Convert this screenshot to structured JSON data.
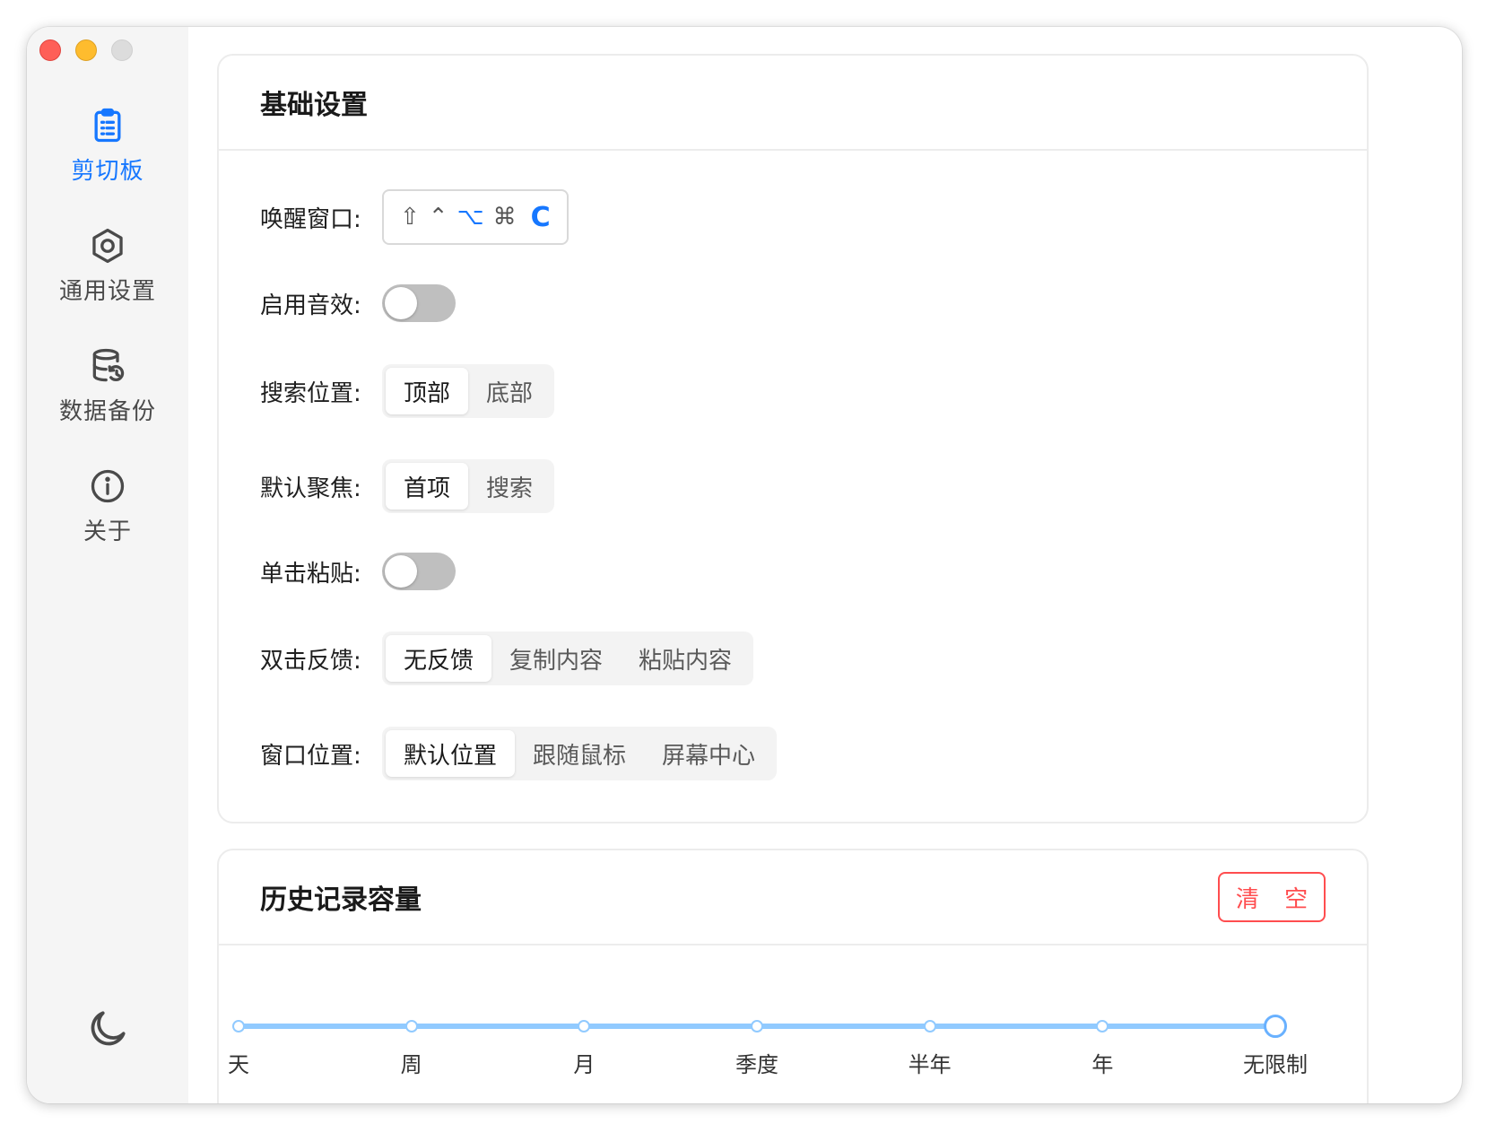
{
  "sidebar": {
    "items": [
      {
        "label": "剪切板",
        "icon": "clipboard-icon",
        "active": true
      },
      {
        "label": "通用设置",
        "icon": "settings-hexagon-icon",
        "active": false
      },
      {
        "label": "数据备份",
        "icon": "database-backup-icon",
        "active": false
      },
      {
        "label": "关于",
        "icon": "info-circle-icon",
        "active": false
      }
    ],
    "theme_toggle_icon": "moon-icon"
  },
  "basic": {
    "title": "基础设置",
    "wake_window": {
      "label": "唤醒窗口:",
      "keys": [
        "⇧",
        "⌃",
        "⌥",
        "⌘",
        "C"
      ]
    },
    "sound": {
      "label": "启用音效:",
      "enabled": false
    },
    "search_position": {
      "label": "搜索位置:",
      "options": [
        "顶部",
        "底部"
      ],
      "selected": "顶部"
    },
    "default_focus": {
      "label": "默认聚焦:",
      "options": [
        "首项",
        "搜索"
      ],
      "selected": "首项"
    },
    "single_click_paste": {
      "label": "单击粘贴:",
      "enabled": false
    },
    "double_click": {
      "label": "双击反馈:",
      "options": [
        "无反馈",
        "复制内容",
        "粘贴内容"
      ],
      "selected": "无反馈"
    },
    "window_position": {
      "label": "窗口位置:",
      "options": [
        "默认位置",
        "跟随鼠标",
        "屏幕中心"
      ],
      "selected": "默认位置"
    }
  },
  "history": {
    "title": "历史记录容量",
    "clear_label": "清 空",
    "marks": [
      "天",
      "周",
      "月",
      "季度",
      "半年",
      "年",
      "无限制"
    ],
    "selected": "无限制"
  },
  "colors": {
    "accent": "#1677ff",
    "danger": "#ff4d4f",
    "slider": "#91caff"
  }
}
